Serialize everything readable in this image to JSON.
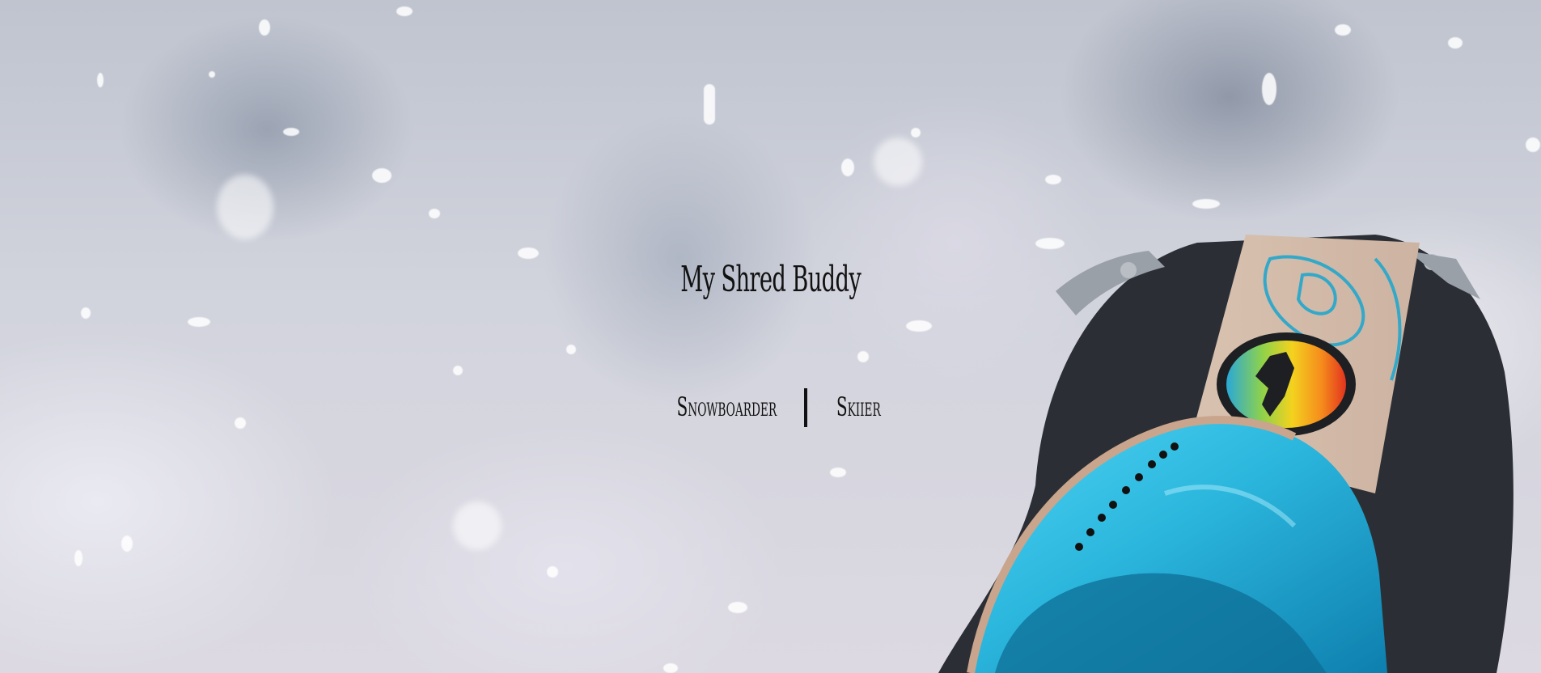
{
  "page": {
    "title": "My Shred Buddy"
  },
  "roles": {
    "snowboarder_label": "Snowboarder",
    "skiier_label": "Skiier"
  },
  "colors": {
    "text": "#111111",
    "lens_blue": "#2bb6dd"
  },
  "icons": {
    "background": "snow-goggles-photo"
  }
}
